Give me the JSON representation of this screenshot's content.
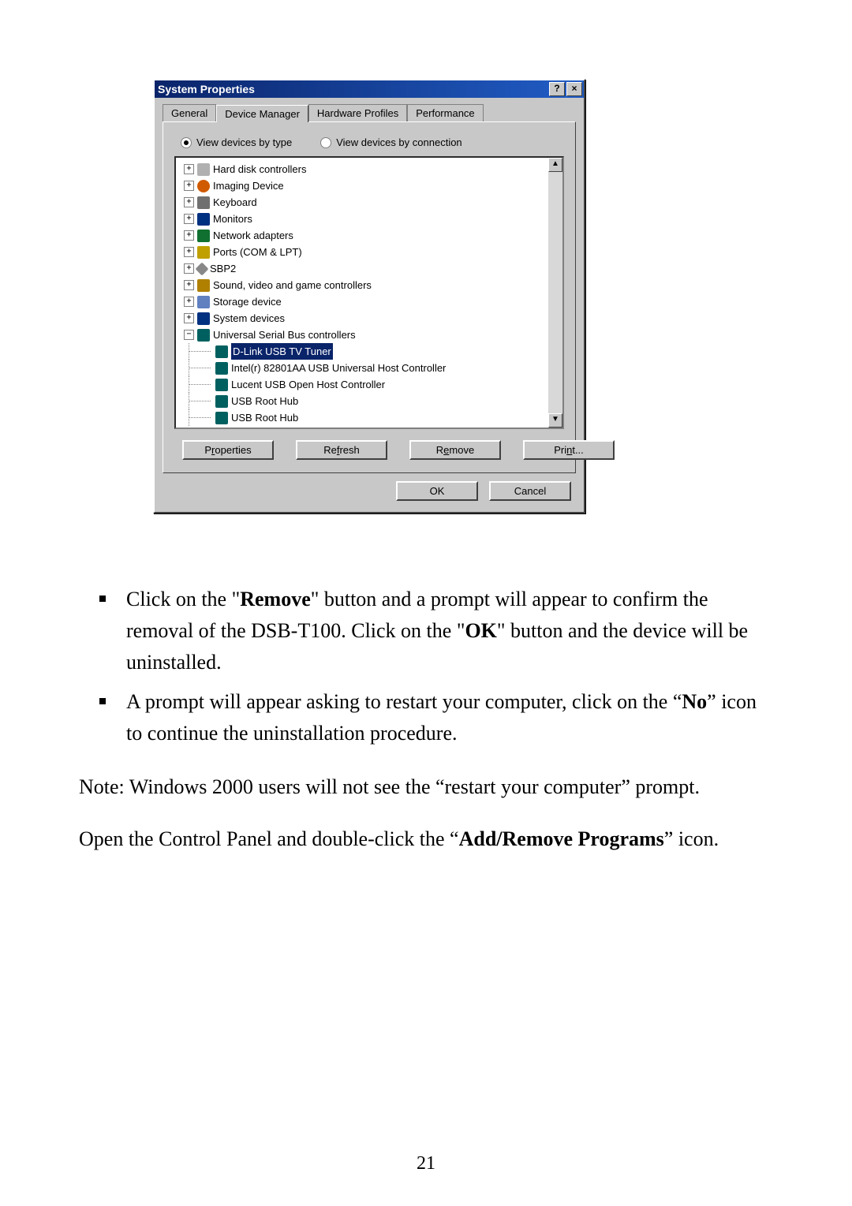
{
  "dialog": {
    "title": "System Properties",
    "help_btn": "?",
    "close_btn": "×",
    "tabs": {
      "general": "General",
      "device_manager": "Device Manager",
      "hardware_profiles": "Hardware Profiles",
      "performance": "Performance",
      "dm_mn": "M",
      "hp_mn": "H",
      "pf_mn": "P"
    },
    "radios": {
      "by_type_pre": "View devices by ",
      "by_type_mn": "t",
      "by_type_post": "ype",
      "by_conn_pre": "View devices by ",
      "by_conn_mn": "c",
      "by_conn_post": "onnection"
    },
    "tree": {
      "items": [
        {
          "exp": "+",
          "icon": "disk",
          "label": "Hard disk controllers"
        },
        {
          "exp": "+",
          "icon": "imaging",
          "label": "Imaging Device"
        },
        {
          "exp": "+",
          "icon": "keyboard",
          "label": "Keyboard"
        },
        {
          "exp": "+",
          "icon": "monitor",
          "label": "Monitors"
        },
        {
          "exp": "+",
          "icon": "network",
          "label": "Network adapters"
        },
        {
          "exp": "+",
          "icon": "ports",
          "label": "Ports (COM & LPT)"
        },
        {
          "exp": "+",
          "icon": "sbp2",
          "label": "SBP2"
        },
        {
          "exp": "+",
          "icon": "sound",
          "label": "Sound, video and game controllers"
        },
        {
          "exp": "+",
          "icon": "storage",
          "label": "Storage device"
        },
        {
          "exp": "+",
          "icon": "system",
          "label": "System devices"
        },
        {
          "exp": "−",
          "icon": "usb",
          "label": "Universal Serial Bus controllers"
        }
      ],
      "children": [
        {
          "label": "D-Link USB TV Tuner",
          "selected": true
        },
        {
          "label": "Intel(r) 82801AA USB Universal Host Controller"
        },
        {
          "label": "Lucent USB Open Host Controller"
        },
        {
          "label": "USB Root Hub"
        },
        {
          "label": "USB Root Hub"
        }
      ],
      "scroll_up": "▲",
      "scroll_down": "▼"
    },
    "buttons": {
      "properties_pre": "P",
      "properties_mn": "r",
      "properties_post": "operties",
      "refresh_pre": "Re",
      "refresh_mn": "f",
      "refresh_post": "resh",
      "remove_pre": "R",
      "remove_mn": "e",
      "remove_post": "move",
      "print_pre": "Pri",
      "print_mn": "n",
      "print_post": "t..."
    },
    "ok": "OK",
    "cancel": "Cancel"
  },
  "doc": {
    "b1_a": "Click on the \"",
    "b1_bold1": "Remove",
    "b1_b": "\" button and a prompt will appear to confirm the removal of the DSB-T100. Click on the \"",
    "b1_bold2": "OK",
    "b1_c": "\" button and the device will be uninstalled.",
    "b2_a": "A prompt will appear asking to restart your computer, click on the “",
    "b2_bold": "No",
    "b2_b": "” icon to continue the uninstallation procedure.",
    "note": "Note: Windows 2000 users will not see the “restart your computer” prompt.",
    "open_a": "Open the Control Panel and double-click the “",
    "open_bold": "Add/Remove Programs",
    "open_b": "” icon.",
    "page": "21"
  }
}
